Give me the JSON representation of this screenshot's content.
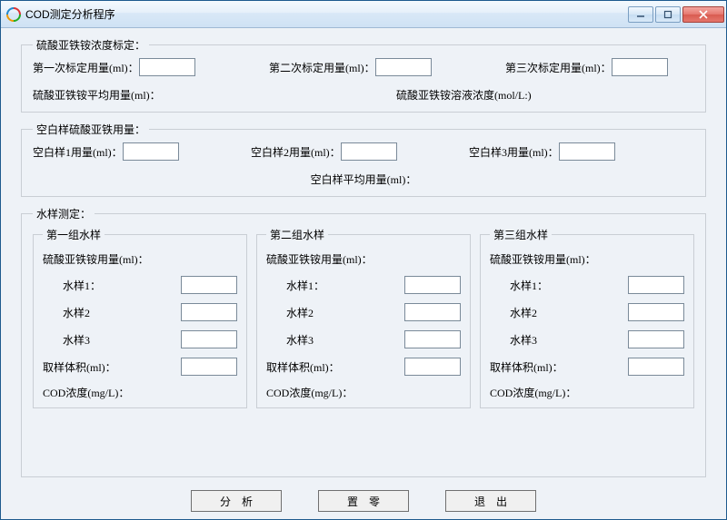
{
  "window": {
    "title": "COD测定分析程序"
  },
  "calibration": {
    "legend": "硫酸亚铁铵浓度标定：",
    "first_label": "第一次标定用量(ml)：",
    "first_value": "",
    "second_label": "第二次标定用量(ml)：",
    "second_value": "",
    "third_label": "第三次标定用量(ml)：",
    "third_value": "",
    "avg_label": "硫酸亚铁铵平均用量(ml)：",
    "conc_label": "硫酸亚铁铵溶液浓度(mol/L:)"
  },
  "blank": {
    "legend": "空白样硫酸亚铁用量：",
    "b1_label": "空白样1用量(ml)：",
    "b1_value": "",
    "b2_label": "空白样2用量(ml)：",
    "b2_value": "",
    "b3_label": "空白样3用量(ml)：",
    "b3_value": "",
    "avg_label": "空白样平均用量(ml)："
  },
  "samples": {
    "legend": "水样测定：",
    "groups": [
      {
        "legend": "第一组水样",
        "usage_label": "硫酸亚铁铵用量(ml)：",
        "s1_label": "水样1：",
        "s1_value": "",
        "s2_label": "水样2",
        "s2_value": "",
        "s3_label": "水样3",
        "s3_value": "",
        "vol_label": "取样体积(ml)：",
        "vol_value": "",
        "cod_label": "COD浓度(mg/L)："
      },
      {
        "legend": "第二组水样",
        "usage_label": "硫酸亚铁铵用量(ml)：",
        "s1_label": "水样1：",
        "s1_value": "",
        "s2_label": "水样2",
        "s2_value": "",
        "s3_label": "水样3",
        "s3_value": "",
        "vol_label": "取样体积(ml)：",
        "vol_value": "",
        "cod_label": "COD浓度(mg/L)："
      },
      {
        "legend": "第三组水样",
        "usage_label": "硫酸亚铁铵用量(ml)：",
        "s1_label": "水样1：",
        "s1_value": "",
        "s2_label": "水样2",
        "s2_value": "",
        "s3_label": "水样3",
        "s3_value": "",
        "vol_label": "取样体积(ml)：",
        "vol_value": "",
        "cod_label": "COD浓度(mg/L)："
      }
    ]
  },
  "buttons": {
    "analyze": "分析",
    "reset": "置零",
    "exit": "退出"
  }
}
